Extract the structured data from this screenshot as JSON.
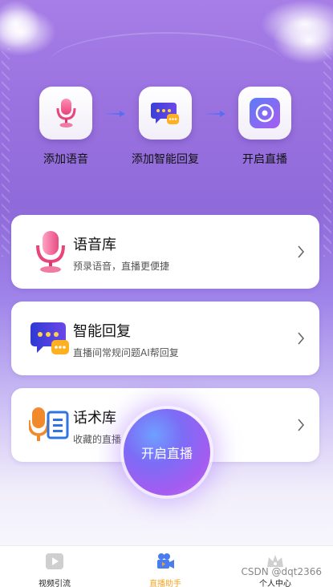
{
  "steps": [
    {
      "label": "添加语音",
      "icon": "microphone-icon"
    },
    {
      "label": "添加智能回复",
      "icon": "chat-bubble-icon"
    },
    {
      "label": "开启直播",
      "icon": "live-button-icon"
    }
  ],
  "cards": [
    {
      "title": "语音库",
      "desc": "预录语音，直播更便捷",
      "icon": "microphone-icon"
    },
    {
      "title": "智能回复",
      "desc": "直播间常规问题AI帮回复",
      "icon": "chat-bubble-icon"
    },
    {
      "title": "话术库",
      "desc": "收藏的直播",
      "icon": "speech-script-icon"
    }
  ],
  "center_button": {
    "label": "开启直播"
  },
  "tabs": [
    {
      "label": "视频引流",
      "icon": "video-play-icon",
      "active": false
    },
    {
      "label": "直播助手",
      "icon": "video-camera-icon",
      "active": true
    },
    {
      "label": "个人中心",
      "icon": "crown-icon",
      "active": false
    }
  ],
  "watermark": "CSDN @dqt2366",
  "colors": {
    "accent": "#f5a623",
    "brand_purple": "#8f6ad9",
    "button_blue": "#7c6cf6"
  }
}
